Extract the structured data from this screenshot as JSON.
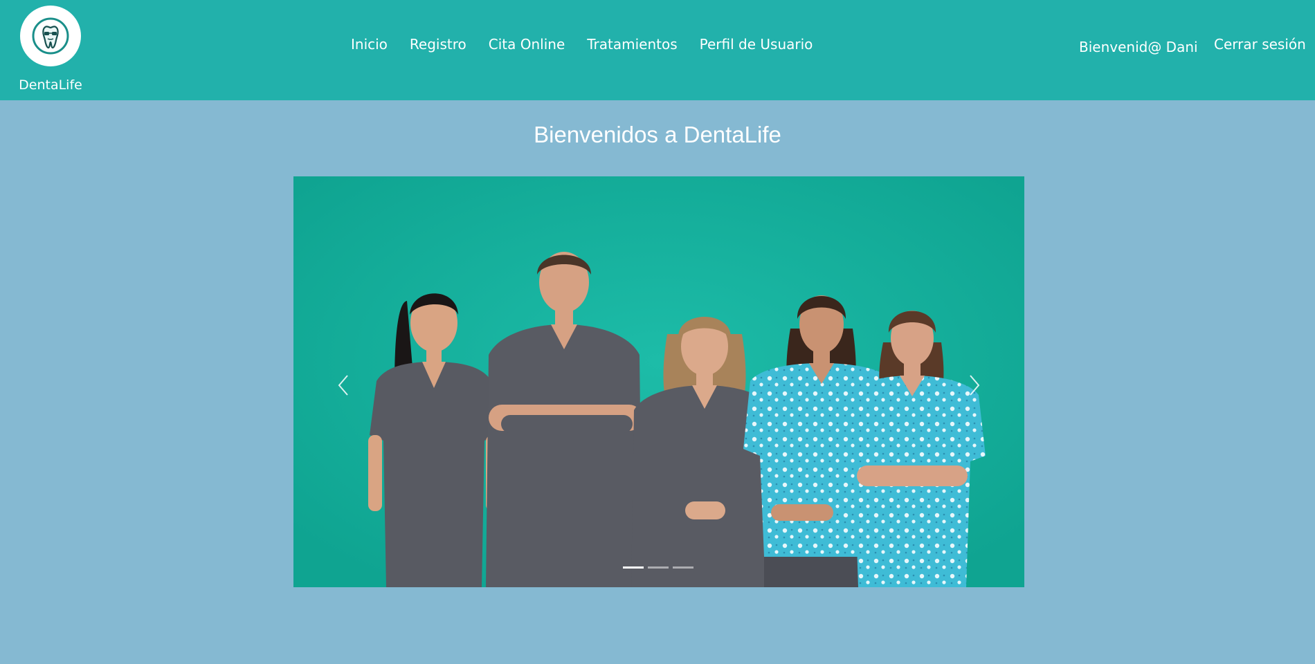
{
  "brand": {
    "name": "DentaLife",
    "logo_icon": "tooth-icon"
  },
  "nav": {
    "links": [
      "Inicio",
      "Registro",
      "Cita Online",
      "Tratamientos",
      "Perfil de Usuario"
    ],
    "welcome": "Bienvenid@ Dani",
    "logout": "Cerrar sesión"
  },
  "main": {
    "title": "Bienvenidos a DentaLife"
  },
  "carousel": {
    "slide_image": "dental-team-photo",
    "prev_icon": "chevron-left-icon",
    "next_icon": "chevron-right-icon",
    "slide_count": 3,
    "active_index": 0
  },
  "colors": {
    "navbar": "#22b1ab",
    "page_background": "#85b9d2",
    "slide_background": "#14ad9b",
    "text": "#ffffff"
  }
}
